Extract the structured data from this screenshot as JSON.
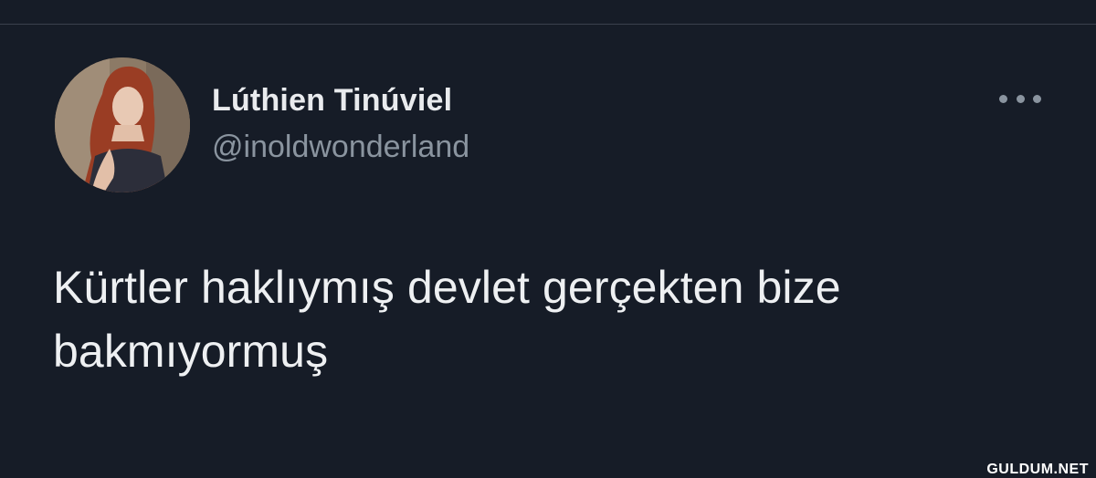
{
  "tweet": {
    "author": {
      "display_name": "Lúthien Tinúviel",
      "handle": "@inoldwonderland"
    },
    "text": "Kürtler haklıymış devlet gerçekten bize bakmıyormuş",
    "more_icon": "ellipsis-icon"
  },
  "watermark": "GULDUM.NET",
  "colors": {
    "background": "#161c27",
    "primary_text": "#eef0f2",
    "secondary_text": "#8a949f"
  }
}
